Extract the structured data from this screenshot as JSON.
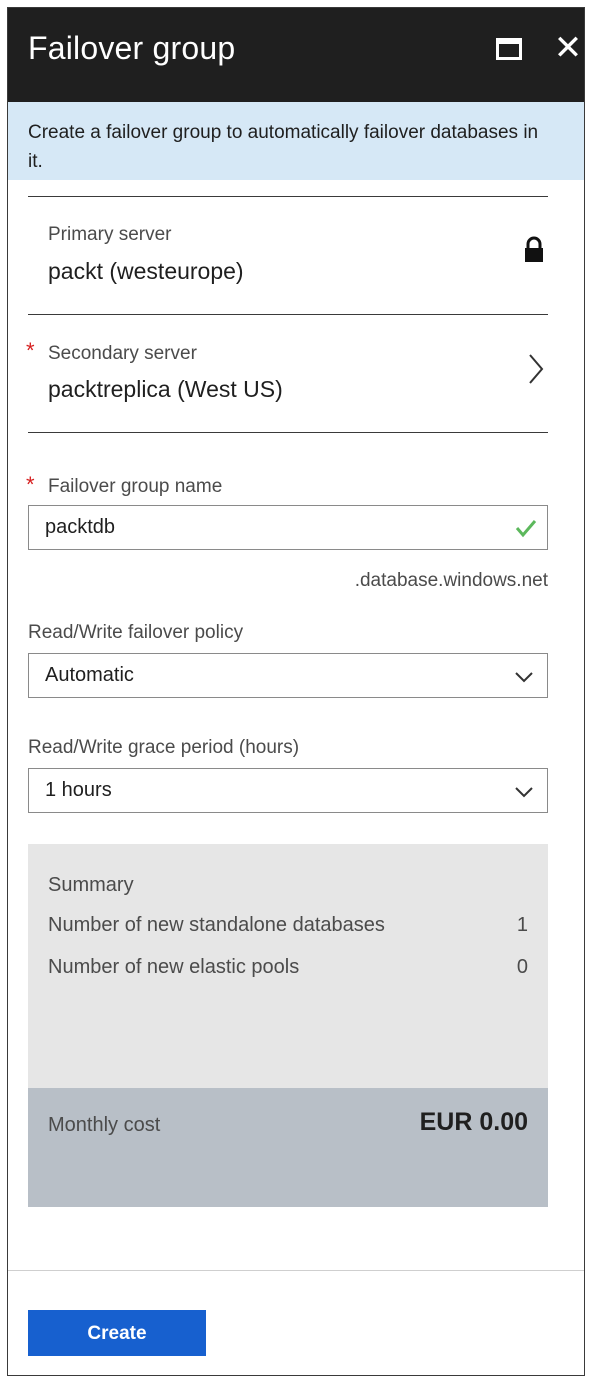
{
  "header": {
    "title": "Failover group",
    "maximize_icon": "maximize-icon",
    "close_icon": "close-icon",
    "close_glyph": "✕"
  },
  "info": {
    "text": "Create a failover group to automatically failover databases in it."
  },
  "primary_server": {
    "label": "Primary server",
    "value": "packt (westeurope)",
    "icon": "lock-icon"
  },
  "secondary_server": {
    "required_mark": "*",
    "label": "Secondary server",
    "value": "packtreplica (West US)",
    "icon": "chevron-right-icon"
  },
  "group_name": {
    "required_mark": "*",
    "label": "Failover group name",
    "value": "packtdb",
    "suffix": ".database.windows.net",
    "icon": "check-icon"
  },
  "rw_policy": {
    "label": "Read/Write failover policy",
    "selected": "Automatic",
    "icon": "chevron-down-icon"
  },
  "grace_period": {
    "label": "Read/Write grace period (hours)",
    "selected": "1 hours",
    "icon": "chevron-down-icon"
  },
  "summary": {
    "title": "Summary",
    "rows": [
      {
        "label": "Number of new standalone databases",
        "value": "1"
      },
      {
        "label": "Number of new elastic pools",
        "value": "0"
      }
    ]
  },
  "cost": {
    "label": "Monthly cost",
    "value": "EUR 0.00"
  },
  "footer": {
    "create_label": "Create"
  },
  "colors": {
    "header_bg": "#1f1f1f",
    "info_bg": "#d6e8f6",
    "required": "#d61f1f",
    "check": "#5cb85c",
    "summary_bg": "#e6e6e6",
    "cost_bg": "#b8bfc7",
    "primary_button": "#1760cf"
  }
}
